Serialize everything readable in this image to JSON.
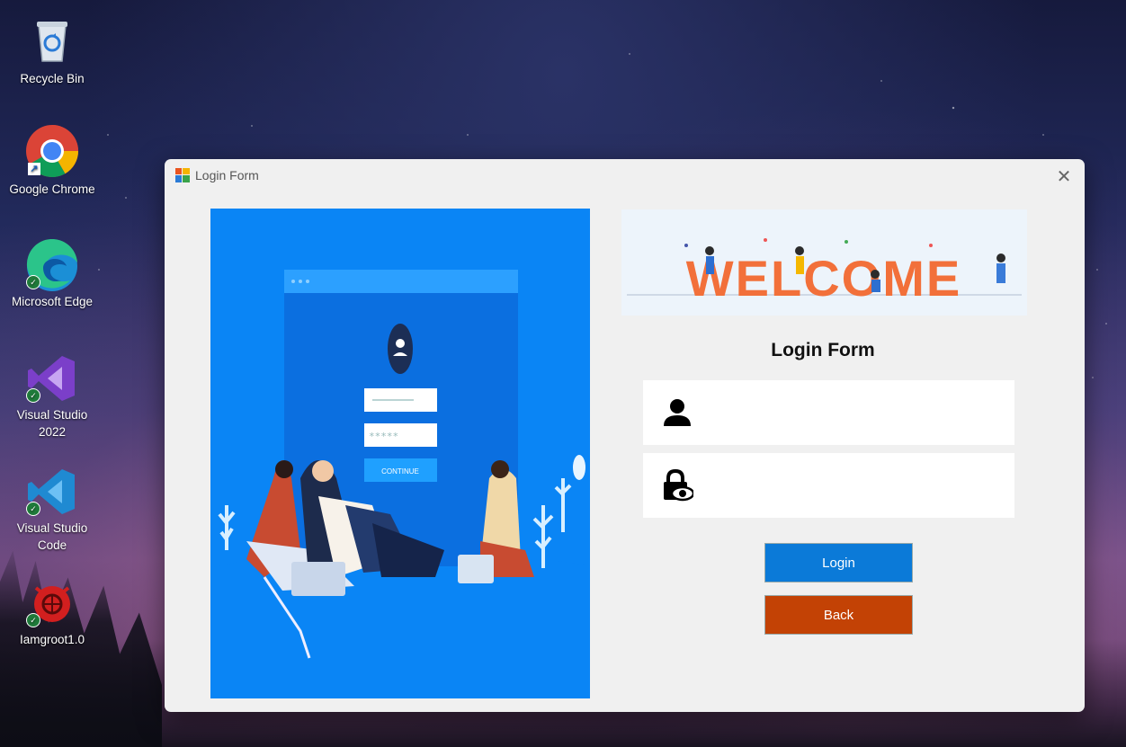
{
  "desktop": {
    "icons": [
      {
        "label": "Recycle Bin",
        "icon": "recycle-bin-icon"
      },
      {
        "label": "Google Chrome",
        "icon": "chrome-icon"
      },
      {
        "label": "Microsoft Edge",
        "icon": "edge-icon"
      },
      {
        "label": "Visual Studio 2022",
        "icon": "visual-studio-icon"
      },
      {
        "label": "Visual Studio Code",
        "icon": "vscode-icon"
      },
      {
        "label": "Iamgroot1.0",
        "icon": "iamgroot-app-icon"
      }
    ]
  },
  "window": {
    "title": "Login Form",
    "close_glyph": "✕"
  },
  "illustration": {
    "continue_label": "CONTINUE",
    "password_mask": "*****"
  },
  "banner": {
    "text": "WELCOME"
  },
  "form": {
    "heading": "Login Form",
    "username": {
      "value": "",
      "placeholder": "",
      "icon": "user-icon"
    },
    "password": {
      "value": "",
      "placeholder": "",
      "icon": "lock-eye-icon"
    },
    "login_label": "Login",
    "back_label": "Back"
  },
  "colors": {
    "login_button": "#0b7ad8",
    "back_button": "#c34205",
    "illustration_bg": "#0a85f5",
    "welcome_text": "#f2703a"
  }
}
